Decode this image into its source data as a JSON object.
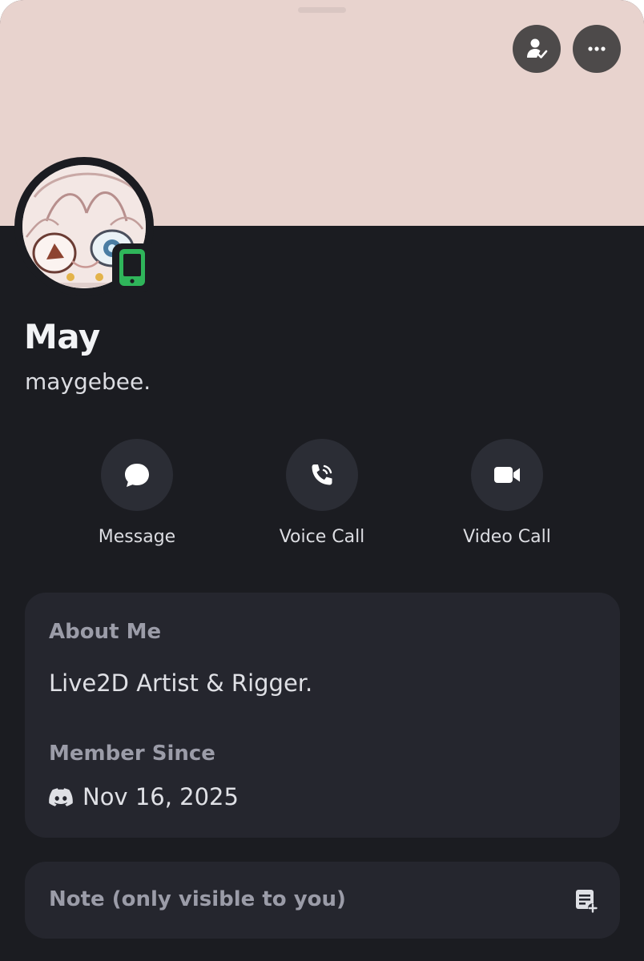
{
  "header": {
    "friend_icon": "person-check-icon",
    "more_icon": "ellipsis-icon",
    "banner_color": "#e8d3ce"
  },
  "profile": {
    "display_name": "May",
    "username": "maygebee.",
    "status_icon": "mobile-online-icon",
    "status_color": "#2fb55a"
  },
  "actions": [
    {
      "label": "Message",
      "icon": "chat-bubble-icon"
    },
    {
      "label": "Voice Call",
      "icon": "phone-icon"
    },
    {
      "label": "Video Call",
      "icon": "video-camera-icon"
    }
  ],
  "about": {
    "title": "About Me",
    "text": "Live2D Artist & Rigger.",
    "member_since_title": "Member Since",
    "member_since_icon": "discord-logo-icon",
    "member_since_date": "Nov 16, 2025"
  },
  "note": {
    "placeholder": "Note (only visible to you)",
    "icon": "note-add-icon"
  }
}
